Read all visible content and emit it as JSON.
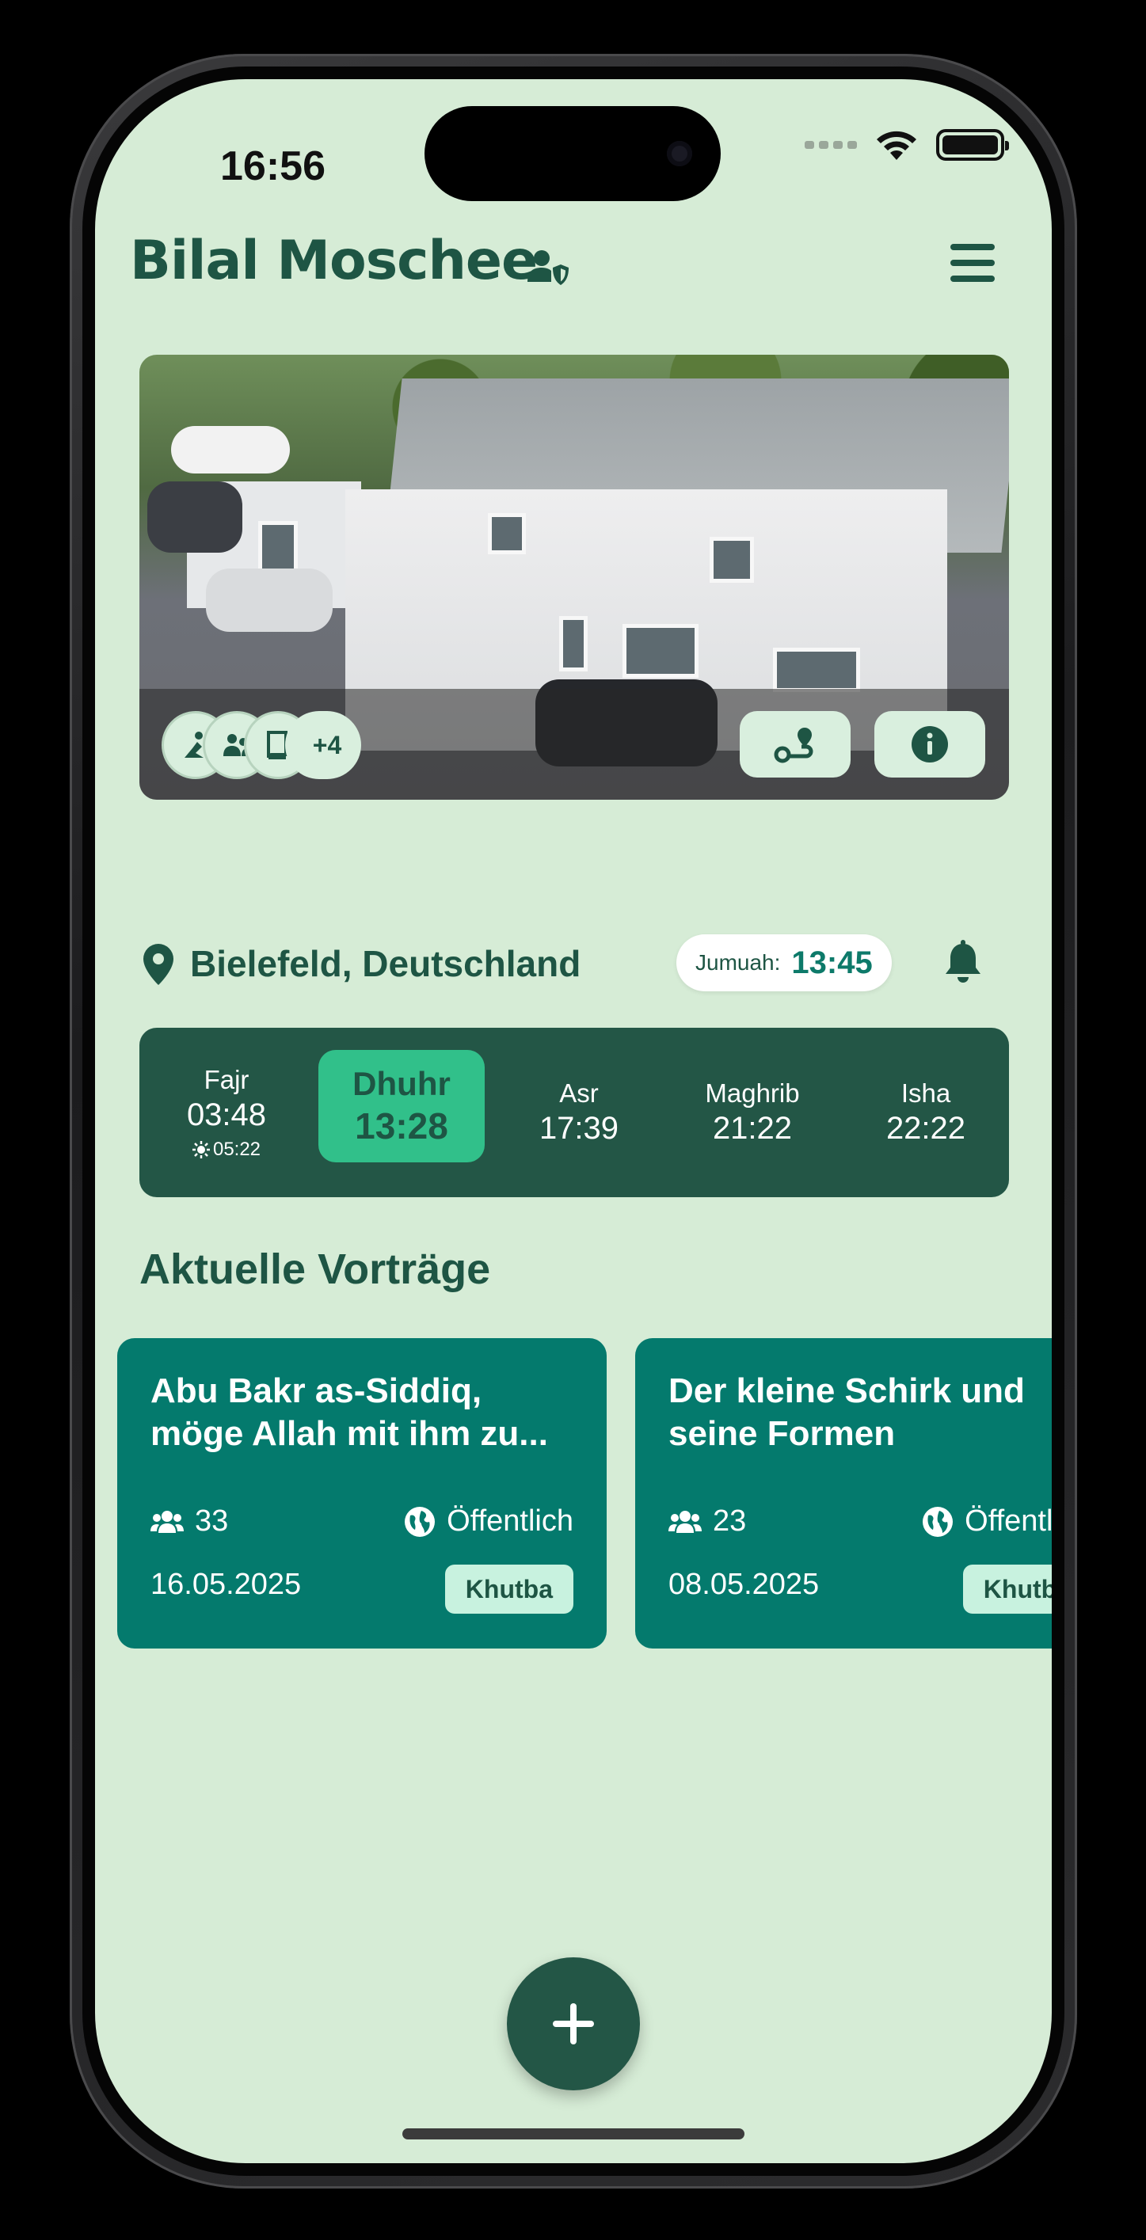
{
  "status_bar": {
    "time": "16:56"
  },
  "header": {
    "title": "Bilal Moschee"
  },
  "hero": {
    "amenities_more": "+4",
    "amenity_icons": [
      "prayer-person-icon",
      "group-people-icon",
      "book-icon"
    ]
  },
  "location": {
    "text": "Bielefeld, Deutschland",
    "jumuah_label": "Jumuah:",
    "jumuah_time": "13:45"
  },
  "prayers": [
    {
      "name": "Fajr",
      "time": "03:48",
      "sunrise": "05:22",
      "active": false
    },
    {
      "name": "Dhuhr",
      "time": "13:28",
      "active": true
    },
    {
      "name": "Asr",
      "time": "17:39",
      "active": false
    },
    {
      "name": "Maghrib",
      "time": "21:22",
      "active": false
    },
    {
      "name": "Isha",
      "time": "22:22",
      "active": false
    }
  ],
  "lectures": {
    "section_title": "Aktuelle Vorträge",
    "items": [
      {
        "title": "Abu Bakr as-Siddiq, möge Allah mit ihm zu...",
        "attendees": "33",
        "visibility": "Öffentlich",
        "date": "16.05.2025",
        "badge": "Khutba"
      },
      {
        "title": "Der kleine Schirk und seine Formen",
        "attendees": "23",
        "visibility": "Öffentlich",
        "date": "08.05.2025",
        "badge": "Khutba"
      }
    ]
  },
  "colors": {
    "background": "#d6ecd6",
    "primary_dark": "#235646",
    "title_green": "#1e5544",
    "card_teal": "#047a6d",
    "active_prayer": "#31c08a",
    "badge_bg": "#c8f2df"
  }
}
